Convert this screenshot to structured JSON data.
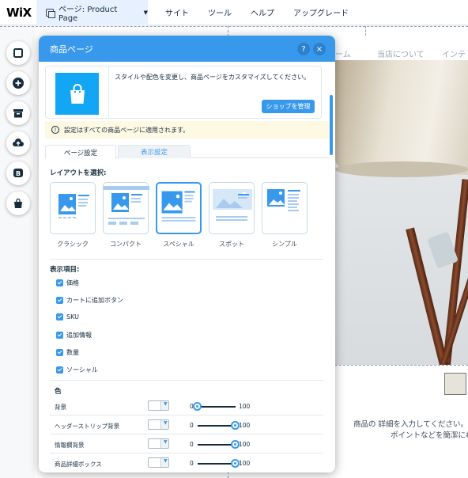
{
  "topbar": {
    "logo": "WiX",
    "page_selector": "ページ: Product Page",
    "menu": [
      "サイト",
      "ツール",
      "ヘルプ",
      "アップグレード"
    ]
  },
  "site": {
    "nav": [
      "ーム",
      "当店について",
      "インテリア"
    ],
    "description_lines": [
      "商品の 詳細を入力してください。あなた",
      "ポイントなどを簡潔にわか"
    ]
  },
  "toolbar": {
    "icons": [
      "square-icon",
      "plus-icon",
      "box-icon",
      "upload-icon",
      "blog-icon",
      "shopping-bag-icon"
    ]
  },
  "panel": {
    "title": "商品ページ",
    "help": "?",
    "close": "×",
    "shop_description": "スタイルや配色を変更し、商品ページをカスタマイズしてください。",
    "manage_button": "ショップを管理",
    "notice": "設定はすべての商品ページに適用されます。",
    "tabs": [
      "ページ設定",
      "表示設定"
    ],
    "layout_title": "レイアウトを選択:",
    "layouts": [
      {
        "label": "クラシック",
        "selected": false
      },
      {
        "label": "コンパクト",
        "selected": false
      },
      {
        "label": "スペシャル",
        "selected": true
      },
      {
        "label": "スポット",
        "selected": false
      },
      {
        "label": "シンプル",
        "selected": false
      }
    ],
    "display_title": "表示項目:",
    "display_items": [
      {
        "label": "価格",
        "checked": true
      },
      {
        "label": "カートに追加ボタン",
        "checked": true
      },
      {
        "label": "SKU",
        "checked": true
      },
      {
        "label": "追加情報",
        "checked": true
      },
      {
        "label": "数量",
        "checked": true
      },
      {
        "label": "ソーシャル",
        "checked": true
      }
    ],
    "color_title": "色",
    "colors": [
      {
        "name": "背景",
        "min": "0",
        "max": "100",
        "opacity": 0
      },
      {
        "name": "ヘッダーストリップ背景",
        "min": "0",
        "max": "100",
        "opacity": 100
      },
      {
        "name": "情報欄背景",
        "min": "0",
        "max": "100",
        "opacity": 100
      },
      {
        "name": "商品詳細ボックス",
        "min": "0",
        "max": "100",
        "opacity": 100
      }
    ]
  },
  "colors": {
    "accent": "#3899ec",
    "bag_tile": "#13a6f5",
    "notice_bg": "#fdf9e3"
  }
}
